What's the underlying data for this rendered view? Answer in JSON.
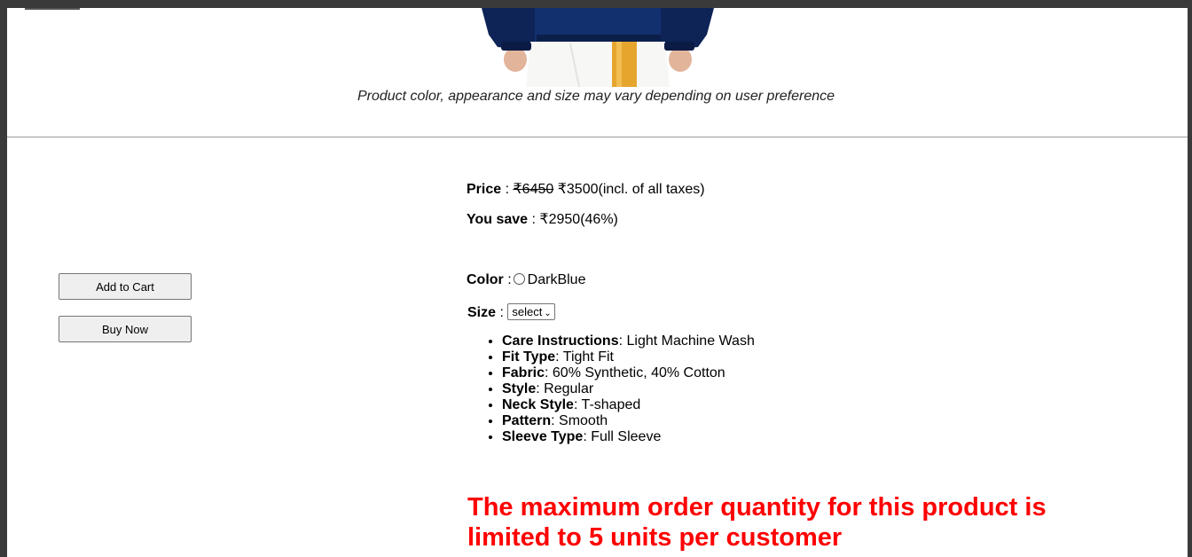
{
  "product": {
    "caption": "Product color, appearance and size may vary depending on user preference"
  },
  "actions": {
    "add_to_cart_label": "Add to Cart",
    "buy_now_label": "Buy Now"
  },
  "pricing": {
    "price_label": "Price",
    "original_price": "₹6450",
    "current_price": "₹3500",
    "tax_note": "(incl. of all taxes)",
    "save_label": "You save",
    "save_value": "₹2950(46%)"
  },
  "options": {
    "color_label": "Color",
    "color_value": "DarkBlue",
    "size_label": "Size",
    "size_selected": "select"
  },
  "attributes": [
    {
      "label": "Care Instructions",
      "value": "Light Machine Wash"
    },
    {
      "label": "Fit Type",
      "value": "Tight Fit"
    },
    {
      "label": "Fabric",
      "value": "60% Synthetic, 40% Cotton"
    },
    {
      "label": "Style",
      "value": "Regular"
    },
    {
      "label": "Neck Style",
      "value": "T-shaped"
    },
    {
      "label": "Pattern",
      "value": "Smooth"
    },
    {
      "label": "Sleeve Type",
      "value": "Full Sleeve"
    }
  ],
  "notice": {
    "text": "The maximum order quantity for this product is limited to 5 units per customer",
    "color": "#ff0000"
  },
  "icons": {
    "radio": "radio-unselected-icon",
    "select_chevron": "chevron-down-icon"
  }
}
